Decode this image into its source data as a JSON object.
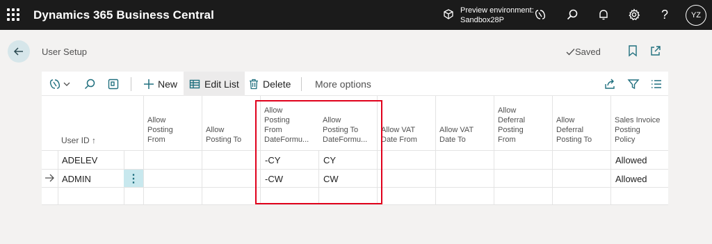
{
  "topbar": {
    "app_title": "Dynamics 365 Business Central",
    "environment_line1": "Preview environment:",
    "environment_line2": "Sandbox28P",
    "avatar_initials": "YZ",
    "icons": [
      "waffle-icon",
      "environment-icon",
      "copilot-icon",
      "search-icon",
      "notification-bell-icon",
      "settings-gear-icon",
      "help-icon"
    ]
  },
  "header": {
    "title": "User Setup",
    "saved_status": "Saved",
    "icons": [
      "back-arrow-icon",
      "checkmark-icon",
      "bookmark-icon",
      "open-new-window-icon"
    ]
  },
  "actionbar": {
    "new_label": "New",
    "edit_list_label": "Edit List",
    "delete_label": "Delete",
    "more_options_label": "More options",
    "icons": [
      "copilot-icon",
      "chevron-down-icon",
      "search-icon",
      "view-icon",
      "plus-icon",
      "edit-list-icon",
      "trash-icon",
      "share-icon",
      "filter-icon",
      "list-view-icon"
    ]
  },
  "grid": {
    "columns": [
      {
        "label": "User ID ↑"
      },
      {
        "label": "Allow\nPosting\nFrom"
      },
      {
        "label": "Allow\nPosting To"
      },
      {
        "label": "Allow\nPosting\nFrom\nDateFormu..."
      },
      {
        "label": "Allow\nPosting To\nDateFormu..."
      },
      {
        "label": "Allow VAT\nDate From"
      },
      {
        "label": "Allow VAT\nDate To"
      },
      {
        "label": "Allow\nDeferral\nPosting\nFrom"
      },
      {
        "label": "Allow\nDeferral\nPosting To"
      },
      {
        "label": "Sales Invoice\nPosting\nPolicy"
      }
    ],
    "rows": [
      {
        "user_id": "ADELEV",
        "from_formula": "-CY",
        "to_formula": "CY",
        "sales_policy": "Allowed"
      },
      {
        "user_id": "ADMIN",
        "from_formula": "-CW",
        "to_formula": "CW",
        "sales_policy": "Allowed"
      }
    ],
    "row_menu_glyph": "⋮"
  },
  "colors": {
    "topbar_bg": "#1b1b1b",
    "accent": "#1f6f7e",
    "highlight_border": "#e0001b"
  }
}
